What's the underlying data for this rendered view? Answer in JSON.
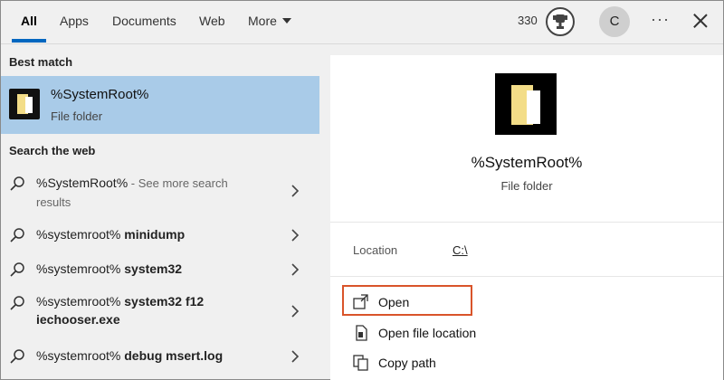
{
  "tabs": [
    {
      "label": "All",
      "active": true
    },
    {
      "label": "Apps"
    },
    {
      "label": "Documents"
    },
    {
      "label": "Web"
    },
    {
      "label": "More"
    }
  ],
  "header": {
    "points": "330",
    "avatar_letter": "C",
    "more_options": "···"
  },
  "left": {
    "best_match_heading": "Best match",
    "best_match": {
      "title": "%SystemRoot%",
      "subtitle": "File folder"
    },
    "search_web_heading": "Search the web",
    "web_results": [
      {
        "prefix": "%SystemRoot%",
        "bold": "",
        "suffix": " - See more search",
        "line2": "results"
      },
      {
        "prefix": "%systemroot% ",
        "bold": "minidump",
        "suffix": "",
        "line2": ""
      },
      {
        "prefix": "%systemroot% ",
        "bold": "system32",
        "suffix": "",
        "line2": ""
      },
      {
        "prefix": "%systemroot% ",
        "bold": "system32 f12",
        "suffix": "",
        "line2": "iechooser.exe"
      },
      {
        "prefix": "%systemroot% ",
        "bold": "debug msert.log",
        "suffix": "",
        "line2": ""
      }
    ]
  },
  "right": {
    "title": "%SystemRoot%",
    "subtitle": "File folder",
    "location_label": "Location",
    "location_value": "C:\\",
    "actions": [
      {
        "label": "Open",
        "icon": "open-icon"
      },
      {
        "label": "Open file location",
        "icon": "file-location-icon"
      },
      {
        "label": "Copy path",
        "icon": "copy-icon"
      }
    ]
  },
  "colors": {
    "accent": "#0067c0",
    "selection": "#a9cbe8",
    "highlight_box": "#d9542a"
  }
}
